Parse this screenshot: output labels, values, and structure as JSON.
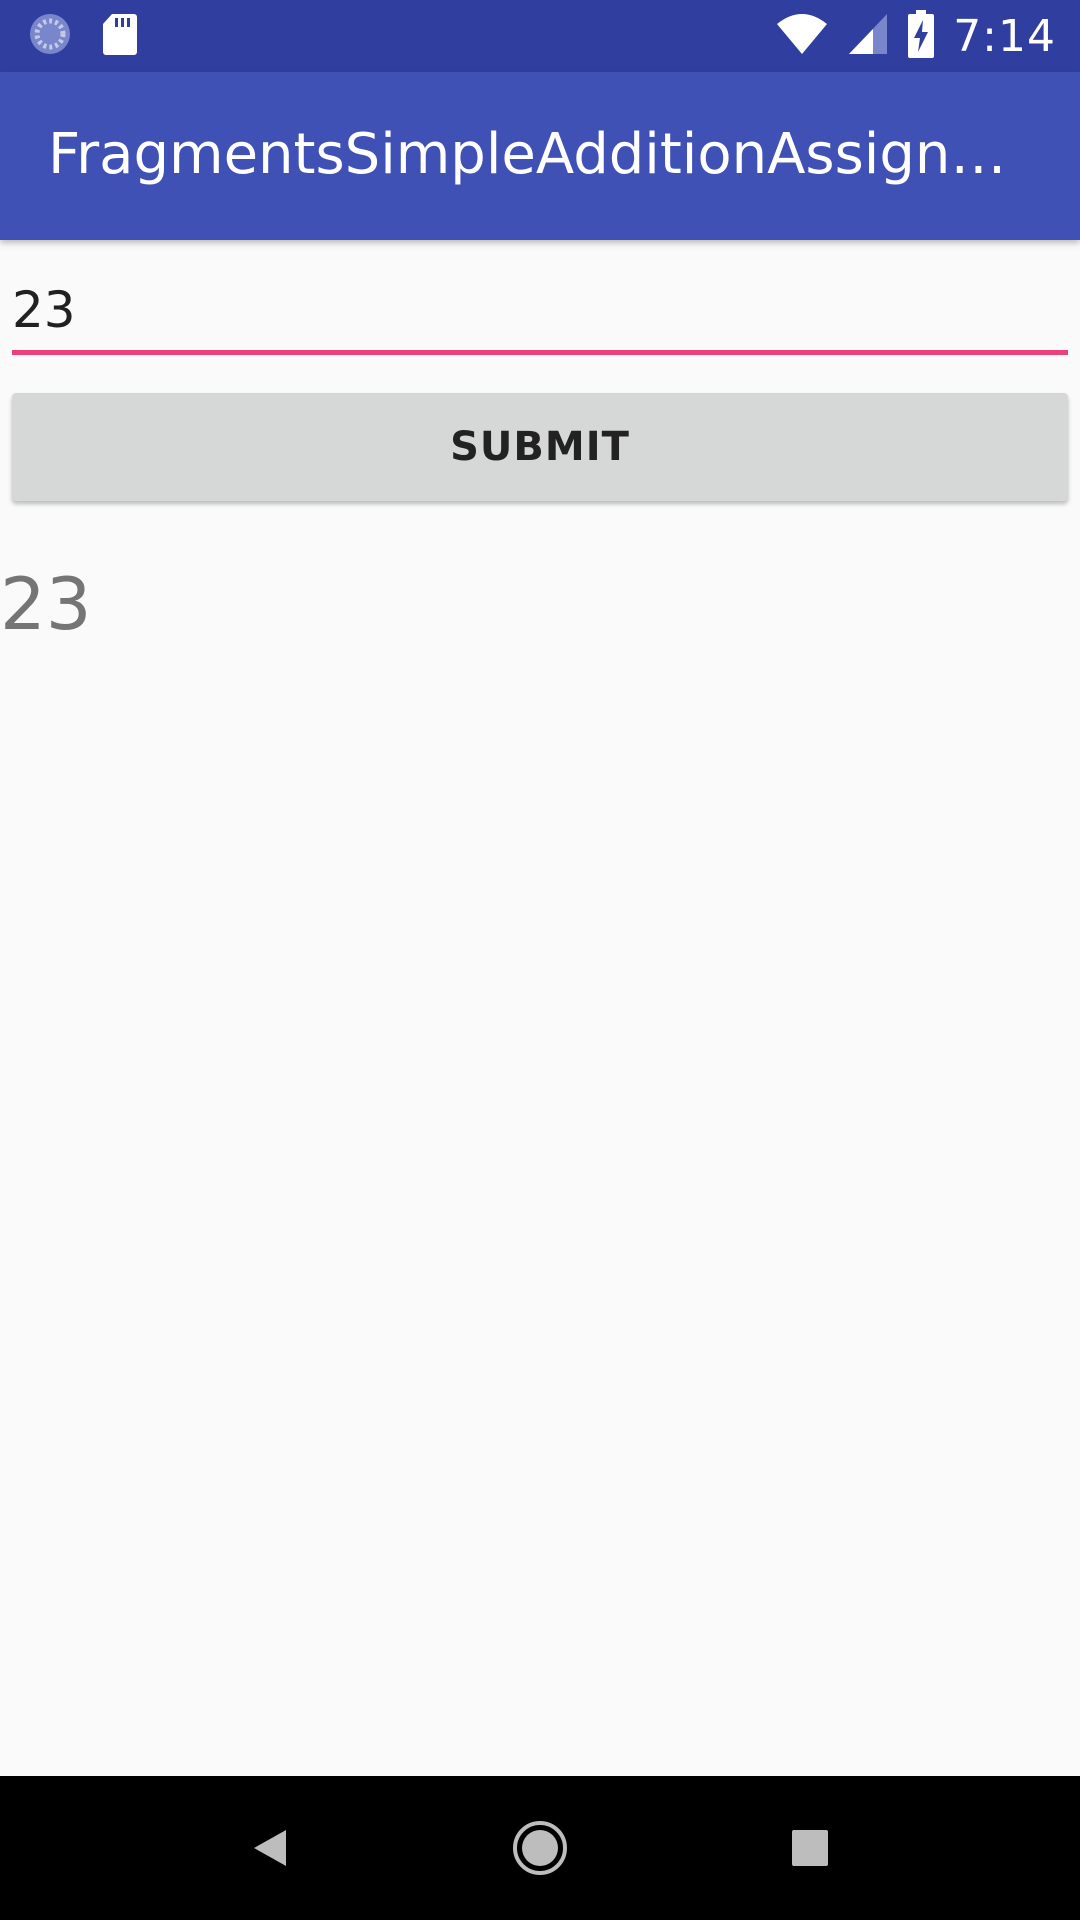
{
  "status_bar": {
    "time": "7:14",
    "left_icons": [
      "sync-icon",
      "sd-card-icon"
    ],
    "right_icons": [
      "wifi-icon",
      "cell-signal-icon",
      "battery-charging-icon"
    ]
  },
  "app_bar": {
    "title": "FragmentsSimpleAdditionAssign…"
  },
  "form": {
    "input_value": "23",
    "submit_label": "SUBMIT",
    "result": "23"
  },
  "nav_bar": {
    "buttons": [
      "back-icon",
      "home-icon",
      "recents-icon"
    ]
  },
  "colors": {
    "status_bar": "#303f9f",
    "app_bar": "#3f51b5",
    "accent": "#e91e63",
    "button": "#d6d7d7",
    "background": "#fafafa"
  }
}
